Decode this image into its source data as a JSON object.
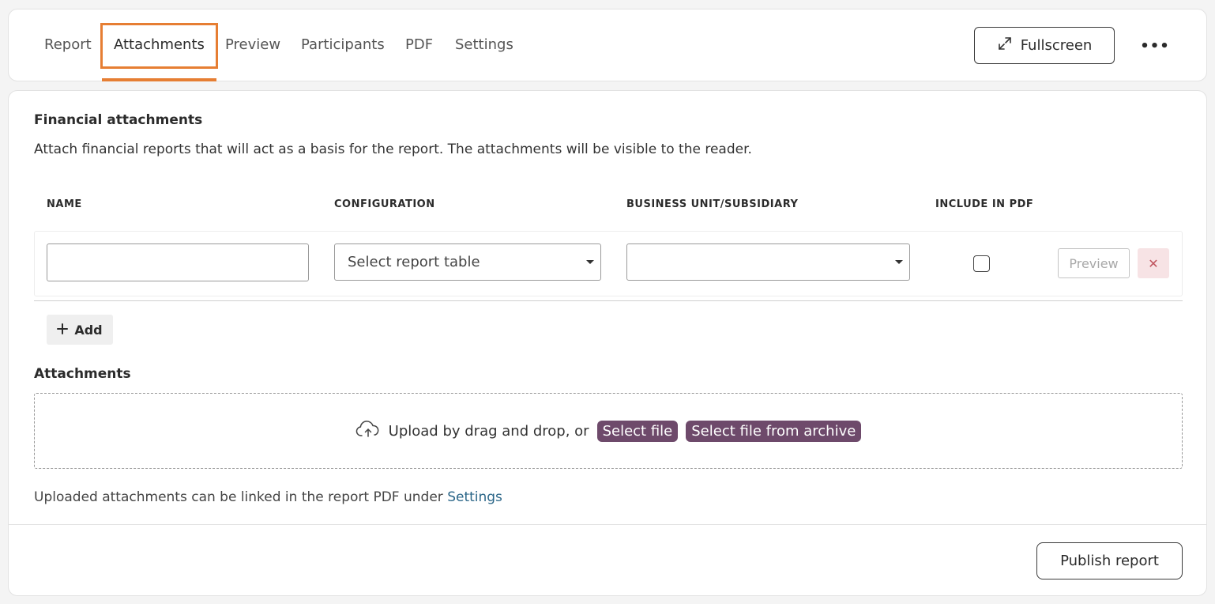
{
  "tabs": {
    "report": "Report",
    "attachments": "Attachments",
    "preview": "Preview",
    "participants": "Participants",
    "pdf": "PDF",
    "settings": "Settings",
    "active": "Attachments"
  },
  "header": {
    "fullscreen_label": "Fullscreen",
    "fullscreen_icon": "expand-arrows-icon",
    "more_label": "•••",
    "more_icon": "more-horizontal-icon"
  },
  "financial": {
    "title": "Financial attachments",
    "description": "Attach financial reports that will act as a basis for the report. The attachments will be visible to the reader.",
    "columns": {
      "name": "NAME",
      "configuration": "CONFIGURATION",
      "business_unit": "BUSINESS UNIT/SUBSIDIARY",
      "include_pdf": "INCLUDE IN PDF"
    },
    "row": {
      "name_value": "",
      "configuration_value": "Select report table",
      "business_unit_value": "",
      "include_in_pdf": false,
      "preview_label": "Preview",
      "remove_label": "✕"
    },
    "add_label": "Add"
  },
  "attachments": {
    "title": "Attachments",
    "upload_text": "Upload by drag and drop, or",
    "select_file_label": "Select file",
    "select_archive_label": "Select file from archive",
    "hint_text": "Uploaded attachments can be linked in the report PDF under",
    "hint_link": "Settings"
  },
  "footer": {
    "publish_label": "Publish report"
  },
  "colors": {
    "accent_orange": "#e67e33",
    "pill_purple": "#6e4a6b",
    "link_blue": "#2b6688",
    "remove_bg": "#f7e3e5"
  }
}
